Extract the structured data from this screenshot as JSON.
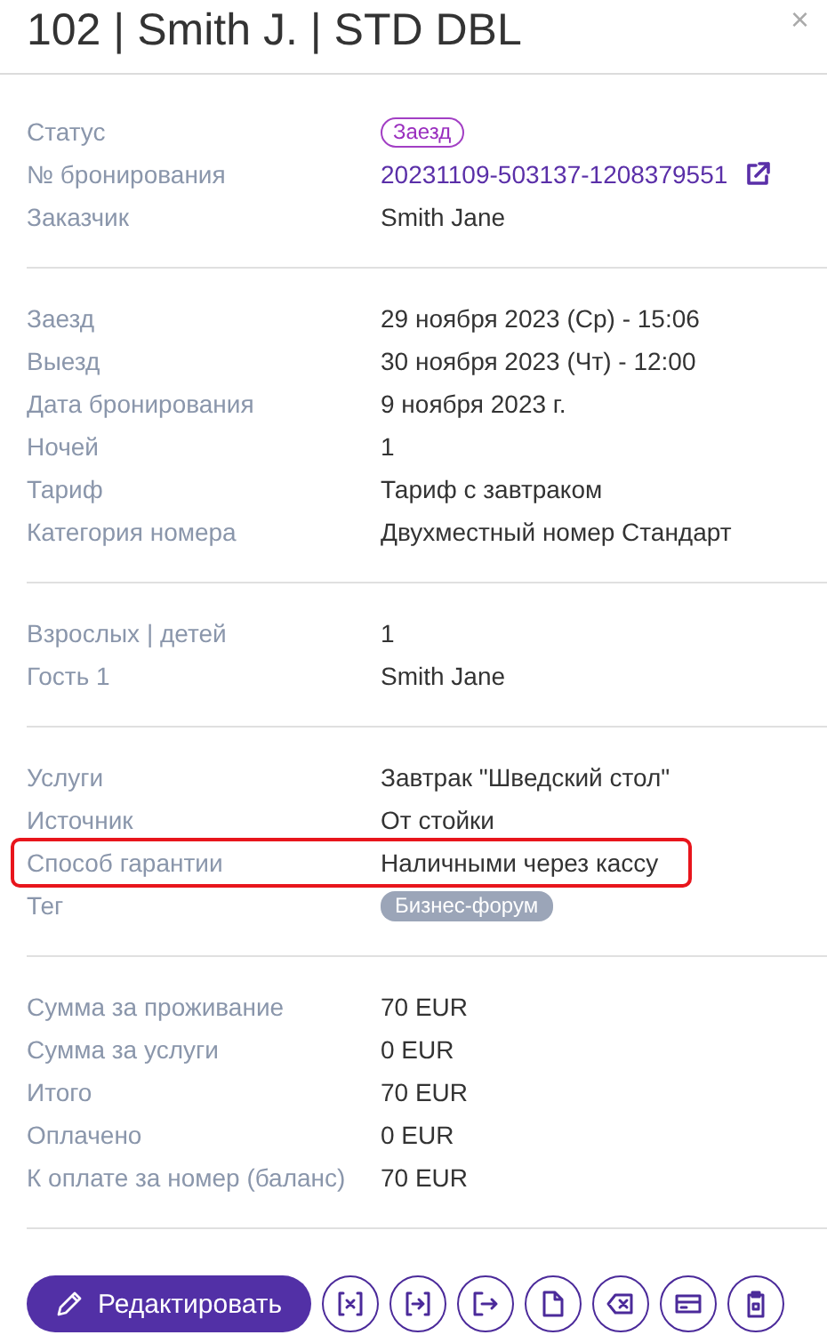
{
  "title": "102 | Smith J. | STD DBL",
  "close": "×",
  "sections": [
    {
      "rows": [
        {
          "label": "Статус",
          "kind": "badge",
          "value": "Заезд",
          "highlighted": false
        },
        {
          "label": "№ бронирования",
          "kind": "link",
          "value": "20231109-503137-1208379551",
          "highlighted": false
        },
        {
          "label": "Заказчик",
          "kind": "text",
          "value": "Smith Jane",
          "highlighted": false
        }
      ]
    },
    {
      "rows": [
        {
          "label": "Заезд",
          "kind": "text",
          "value": "29 ноября 2023 (Ср) - 15:06",
          "highlighted": false
        },
        {
          "label": "Выезд",
          "kind": "text",
          "value": "30 ноября 2023 (Чт) - 12:00",
          "highlighted": false
        },
        {
          "label": "Дата бронирования",
          "kind": "text",
          "value": "9 ноября 2023 г.",
          "highlighted": false
        },
        {
          "label": "Ночей",
          "kind": "text",
          "value": "1",
          "highlighted": false
        },
        {
          "label": "Тариф",
          "kind": "text",
          "value": "Тариф с завтраком",
          "highlighted": false
        },
        {
          "label": "Категория номера",
          "kind": "text",
          "value": "Двухместный номер Стандарт",
          "highlighted": false
        }
      ]
    },
    {
      "rows": [
        {
          "label": "Взрослых | детей",
          "kind": "text",
          "value": "1",
          "highlighted": false
        },
        {
          "label": "Гость 1",
          "kind": "text",
          "value": "Smith Jane",
          "highlighted": false
        }
      ]
    },
    {
      "rows": [
        {
          "label": "Услуги",
          "kind": "text",
          "value": "Завтрак \"Шведский стол\"",
          "highlighted": false
        },
        {
          "label": "Источник",
          "kind": "text",
          "value": "От стойки",
          "highlighted": false
        },
        {
          "label": "Способ гарантии",
          "kind": "text",
          "value": "Наличными через кассу",
          "highlighted": true
        },
        {
          "label": "Тег",
          "kind": "tag",
          "value": "Бизнес-форум",
          "highlighted": false
        }
      ]
    },
    {
      "rows": [
        {
          "label": "Сумма за проживание",
          "kind": "text",
          "value": "70 EUR",
          "highlighted": false
        },
        {
          "label": "Сумма за услуги",
          "kind": "text",
          "value": "0 EUR",
          "highlighted": false
        },
        {
          "label": "Итого",
          "kind": "text",
          "value": "70 EUR",
          "highlighted": false
        },
        {
          "label": "Оплачено",
          "kind": "text",
          "value": "0 EUR",
          "highlighted": false
        },
        {
          "label": "К оплате за номер (баланс)",
          "kind": "text",
          "value": "70 EUR",
          "highlighted": false
        }
      ]
    }
  ],
  "edit_button": "Редактировать",
  "actions": [
    {
      "kind": "cancel"
    },
    {
      "kind": "checkin"
    },
    {
      "kind": "checkout"
    },
    {
      "kind": "document"
    },
    {
      "kind": "delete"
    },
    {
      "kind": "card"
    },
    {
      "kind": "clipboard"
    }
  ]
}
